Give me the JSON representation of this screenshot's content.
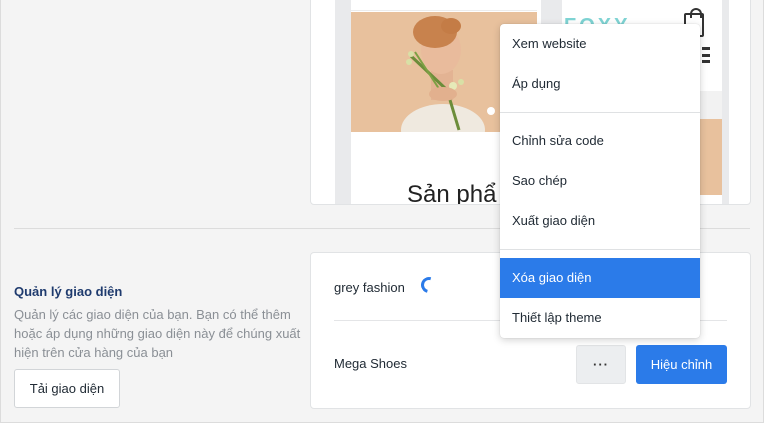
{
  "section": {
    "heading": "Quản lý giao diện",
    "description": "Quản lý các giao diện của bạn. Bạn có thể thêm hoặc áp dụng những giao diện này để chúng xuất hiện trên cửa hàng của bạn",
    "upload_label": "Tải giao diện"
  },
  "preview": {
    "section_title": "Sản phẩ",
    "mobile_logo": "FOXY",
    "logo_color": "#7fd4d4"
  },
  "themes": [
    {
      "name": "grey fashion",
      "loading": true
    },
    {
      "name": "Mega Shoes",
      "more_label": "···",
      "edit_label": "Hiệu chỉnh"
    }
  ],
  "menu": {
    "items": [
      "Xem website",
      "Áp dụng",
      "Chỉnh sửa code",
      "Sao chép",
      "Xuất giao diện",
      "Xóa giao diện",
      "Thiết lập theme"
    ],
    "active_index": 5
  },
  "colors": {
    "accent": "#2b7be9",
    "heading": "#1f3b6e",
    "muted_text": "#8a8f95"
  },
  "icons": {
    "bag": "shopping-bag-icon",
    "menu": "hamburger-menu-icon",
    "loading": "spinner-icon"
  }
}
